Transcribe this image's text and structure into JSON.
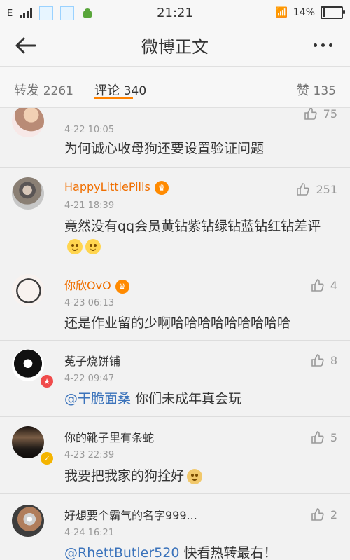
{
  "status": {
    "time": "21:21",
    "battery_percent": "14%",
    "battery_level": 0.14,
    "carrier_indicator": "E"
  },
  "header": {
    "title": "微博正文"
  },
  "tabs": {
    "repost_label": "转发",
    "repost_count": "2261",
    "comment_label": "评论",
    "comment_count": "340",
    "like_label": "赞",
    "like_count": "135"
  },
  "comments": [
    {
      "name": "",
      "time": "4-22 10:05",
      "text": "为何诚心收母狗还要设置验证问题",
      "likes": "75"
    },
    {
      "name": "HappyLittlePills",
      "time": "4-21 18:39",
      "text": "竟然没有qq会员黄钻紫钻绿钻蓝钻红钻差评",
      "likes": "251"
    },
    {
      "name": "你欣OvO",
      "time": "4-23 06:13",
      "text": "还是作业留的少啊哈哈哈哈哈哈哈哈哈",
      "likes": "4"
    },
    {
      "name": "菟子烧饼铺",
      "time": "4-22 09:47",
      "mention": "@干脆面桑",
      "text": "你们未成年真会玩",
      "likes": "8"
    },
    {
      "name": "你的靴子里有条蛇",
      "time": "4-23 22:39",
      "text": "我要把我家的狗拴好",
      "likes": "5"
    },
    {
      "name": "好想要个霸气的名字999...",
      "time": "4-24 16:21",
      "mention": "@RhettButler520",
      "text": "快看热转最右！",
      "likes": "2"
    }
  ],
  "colors": {
    "accent": "#ff8200",
    "mention": "#3b73bb",
    "username": "#f06f00"
  }
}
